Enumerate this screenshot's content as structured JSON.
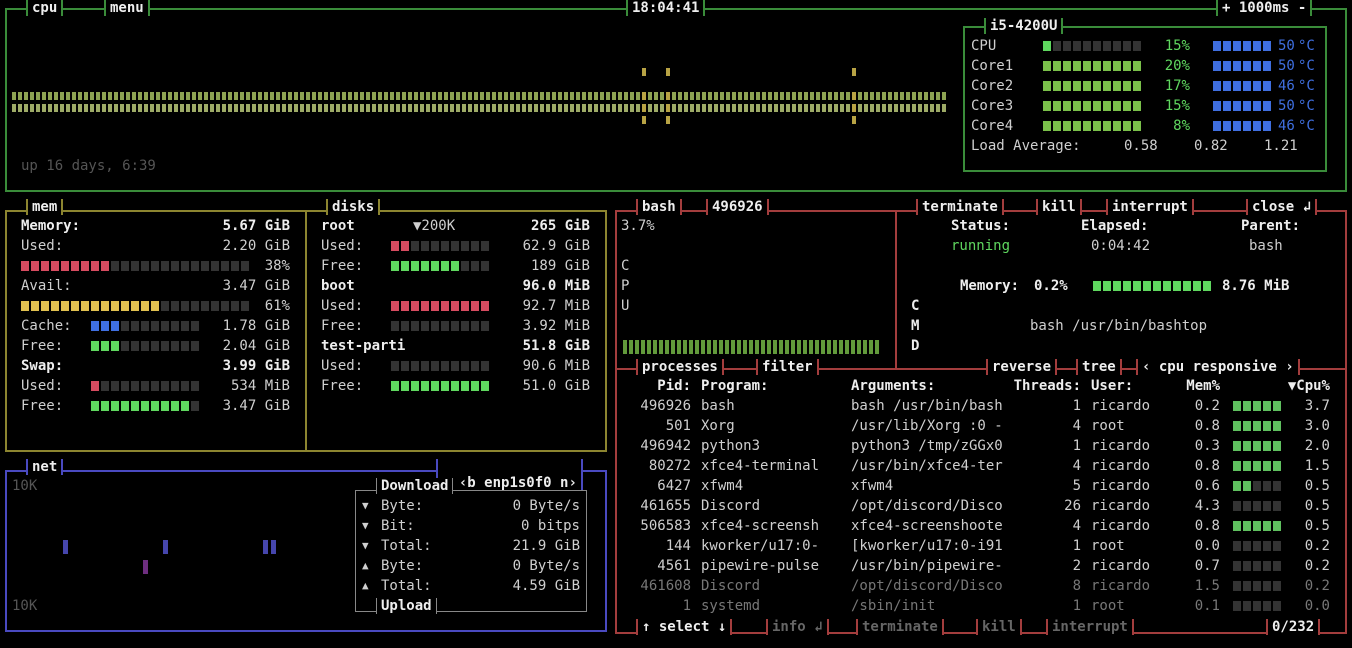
{
  "colors": {
    "cpu_border": "#3a8c3a",
    "mem_border": "#8c8530",
    "net_border": "#4a4ac0",
    "proc_border": "#a33d3d",
    "meter_green": "#5fd75f",
    "meter_blue": "#3f6fe0",
    "meter_red": "#d64b60",
    "meter_yellow": "#e0c050",
    "empty": "#333333"
  },
  "cpu": {
    "title": "cpu",
    "menu": "menu",
    "clock": "18:04:41",
    "rate": "+ 1000ms -",
    "uptime": "up 16 days, 6:39",
    "model": "i5-4200U",
    "rows": [
      {
        "label": "CPU",
        "pct": "15%",
        "temp": "50",
        "unit": "°C",
        "fill": 0.15
      },
      {
        "label": "Core1",
        "pct": "20%",
        "temp": "50",
        "unit": "°C",
        "fill": 1.0
      },
      {
        "label": "Core2",
        "pct": "17%",
        "temp": "46",
        "unit": "°C",
        "fill": 1.0
      },
      {
        "label": "Core3",
        "pct": "15%",
        "temp": "50",
        "unit": "°C",
        "fill": 1.0
      },
      {
        "label": "Core4",
        "pct": "8%",
        "temp": "46",
        "unit": "°C",
        "fill": 1.0
      }
    ],
    "load_label": "Load Average:",
    "load": [
      "0.58",
      "0.82",
      "1.21"
    ]
  },
  "mem": {
    "title": "mem",
    "rows": [
      {
        "label": "Memory:",
        "value": "5.67 GiB",
        "bold": true
      },
      {
        "label": "Used:",
        "value": "2.20 GiB"
      },
      {
        "meter": "red",
        "pct": "38%",
        "fill": 0.38
      },
      {
        "label": "Avail:",
        "value": "3.47 GiB"
      },
      {
        "meter": "yellow",
        "pct": "61%",
        "fill": 0.61
      },
      {
        "label": "Cache:",
        "value": "1.78 GiB",
        "meter": "blue",
        "fill": 0.3
      },
      {
        "label": "Free:",
        "value": "2.04 GiB",
        "meter": "green",
        "fill": 0.3
      },
      {
        "label": "Swap:",
        "value": "3.99 GiB",
        "bold": true
      },
      {
        "label": "Used:",
        "value": "534 MiB",
        "meter": "red",
        "fill": 0.1
      },
      {
        "label": "Free:",
        "value": "3.47 GiB",
        "meter": "green",
        "fill": 0.87
      }
    ]
  },
  "disks": {
    "title": "disks",
    "io": "▼200K",
    "rows": [
      {
        "label": "root",
        "value": "265 GiB",
        "bold": true
      },
      {
        "label": "Used:",
        "value": "62.9 GiB",
        "meter": "red",
        "fill": 0.24
      },
      {
        "label": "Free:",
        "value": "189 GiB",
        "meter": "green",
        "fill": 0.72
      },
      {
        "label": "boot",
        "value": "96.0 MiB",
        "bold": true
      },
      {
        "label": "Used:",
        "value": "92.7 MiB",
        "meter": "red",
        "fill": 0.97
      },
      {
        "label": "Free:",
        "value": "3.92 MiB",
        "meter": "green",
        "fill": 0.0
      },
      {
        "label": "test-parti",
        "value": "51.8 GiB",
        "bold": true
      },
      {
        "label": "Used:",
        "value": "90.6 MiB",
        "meter": "red",
        "fill": 0.0
      },
      {
        "label": "Free:",
        "value": "51.0 GiB",
        "meter": "green",
        "fill": 0.99
      }
    ]
  },
  "net": {
    "title": "net",
    "prev": "‹b",
    "iface": "enp1s0f0",
    "next": "n›",
    "scale_top": "10K",
    "scale_bottom": "10K",
    "download_label": "Download",
    "upload_label": "Upload",
    "rows": [
      {
        "arrow": "▼",
        "label": "Byte:",
        "value": "0 Byte/s"
      },
      {
        "arrow": "▼",
        "label": "Bit:",
        "value": "0 bitps"
      },
      {
        "arrow": "▼",
        "label": "Total:",
        "value": "21.9 GiB"
      },
      {
        "arrow": "▲",
        "label": "Byte:",
        "value": "0 Byte/s"
      },
      {
        "arrow": "▲",
        "label": "Total:",
        "value": "4.59 GiB"
      }
    ]
  },
  "detail": {
    "name": "bash",
    "pid": "496926",
    "cpu_pct": "3.7%",
    "cpu_letters": [
      "C",
      "P",
      "U"
    ],
    "cmd_letters": [
      "C",
      "M",
      "D"
    ],
    "buttons": [
      "terminate",
      "kill",
      "interrupt",
      "close ↲"
    ],
    "status_label": "Status:",
    "status": "running",
    "elapsed_label": "Elapsed:",
    "elapsed": "0:04:42",
    "parent_label": "Parent:",
    "parent": "bash",
    "memory_label": "Memory:",
    "memory_pct": "0.2%",
    "memory_value": "8.76 MiB",
    "cmd": "bash /usr/bin/bashtop"
  },
  "proc": {
    "tabs": [
      "processes",
      "filter",
      "reverse",
      "tree"
    ],
    "sort": "‹ cpu responsive ›",
    "headers": {
      "pid": "Pid:",
      "program": "Program:",
      "args": "Arguments:",
      "threads": "Threads:",
      "user": "User:",
      "mem": "Mem%",
      "cpu": "▼Cpu%"
    },
    "rows": [
      {
        "pid": "496926",
        "program": "bash",
        "args": "bash /usr/bin/bash",
        "threads": "1",
        "user": "ricardo",
        "mem": "0.2",
        "cpu": "3.7",
        "level": 1.0
      },
      {
        "pid": "501",
        "program": "Xorg",
        "args": "/usr/lib/Xorg :0 -",
        "threads": "4",
        "user": "root",
        "mem": "0.8",
        "cpu": "3.0",
        "level": 1.0
      },
      {
        "pid": "496942",
        "program": "python3",
        "args": "python3 /tmp/zGGx0",
        "threads": "1",
        "user": "ricardo",
        "mem": "0.3",
        "cpu": "2.0",
        "level": 1.0
      },
      {
        "pid": "80272",
        "program": "xfce4-terminal",
        "args": "/usr/bin/xfce4-ter",
        "threads": "4",
        "user": "ricardo",
        "mem": "0.8",
        "cpu": "1.5",
        "level": 1.0
      },
      {
        "pid": "6427",
        "program": "xfwm4",
        "args": "xfwm4",
        "threads": "5",
        "user": "ricardo",
        "mem": "0.6",
        "cpu": "0.5",
        "level": 0.4
      },
      {
        "pid": "461655",
        "program": "Discord",
        "args": "/opt/discord/Disco",
        "threads": "26",
        "user": "ricardo",
        "mem": "4.3",
        "cpu": "0.5",
        "level": 0.0
      },
      {
        "pid": "506583",
        "program": "xfce4-screensh",
        "args": "xfce4-screenshoote",
        "threads": "4",
        "user": "ricardo",
        "mem": "0.8",
        "cpu": "0.5",
        "level": 1.0
      },
      {
        "pid": "144",
        "program": "kworker/u17:0-",
        "args": "[kworker/u17:0-i91",
        "threads": "1",
        "user": "root",
        "mem": "0.0",
        "cpu": "0.2",
        "level": 0.0
      },
      {
        "pid": "4561",
        "program": "pipewire-pulse",
        "args": "/usr/bin/pipewire-",
        "threads": "2",
        "user": "ricardo",
        "mem": "0.7",
        "cpu": "0.2",
        "level": 0.0
      },
      {
        "pid": "461608",
        "program": "Discord",
        "args": "/opt/discord/Disco",
        "threads": "8",
        "user": "ricardo",
        "mem": "1.5",
        "cpu": "0.2",
        "level": 0.0
      },
      {
        "pid": "1",
        "program": "systemd",
        "args": "/sbin/init",
        "threads": "1",
        "user": "root",
        "mem": "0.1",
        "cpu": "0.0",
        "level": 0.0
      }
    ],
    "footer": [
      "↑ select ↓",
      "info ↲",
      "terminate",
      "kill",
      "interrupt"
    ],
    "count": "0/232"
  }
}
